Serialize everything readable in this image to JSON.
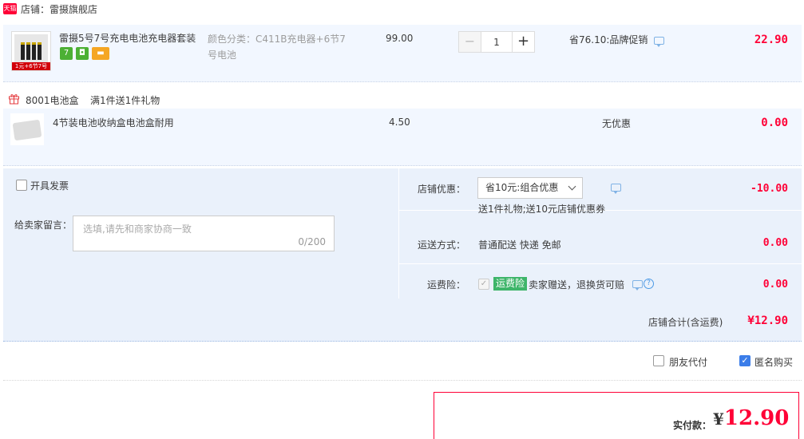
{
  "shop": {
    "badge": "天猫",
    "name": "店铺：雷摄旗舰店"
  },
  "item": {
    "title": "雷摄5号7号充电电池充电器套装",
    "thumb_label": "1元+6节7号",
    "service_icons": [
      {
        "name": "seven-day-icon",
        "glyph": "7",
        "color": "#4cb034"
      },
      {
        "name": "guarantee-icon",
        "glyph": "◘",
        "color": "#4cb034"
      },
      {
        "name": "card-icon",
        "glyph": "▬",
        "color": "#f5a623"
      }
    ],
    "sku": "颜色分类：C411B充电器+6节7号电池",
    "price": "99.00",
    "qty": "1",
    "qty_minus": "−",
    "qty_plus": "+",
    "promo": "省76.10:品牌促销",
    "subtotal": "22.90"
  },
  "gift": {
    "name": "8001电池盒",
    "rule": "满1件送1件礼物",
    "title": "4节装电池收纳盒电池盒耐用",
    "price": "4.50",
    "promo": "无优惠",
    "subtotal": "0.00"
  },
  "options": {
    "invoice_label": "开具发票",
    "message_label": "给卖家留言：",
    "message_placeholder": "选填,请先和商家协商一致",
    "message_count": "0/200",
    "shop_discount_label": "店铺优惠：",
    "shop_discount_value": "省10元:组合优惠",
    "shop_discount_note": "送1件礼物;送10元店铺优惠券",
    "shop_discount_amount": "-10.00",
    "shipping_label": "运送方式：",
    "shipping_value": "普通配送 快递 免邮",
    "shipping_amount": "0.00",
    "insurance_label": "运费险：",
    "insurance_tag": "运费险",
    "insurance_text": "卖家赠送，退换货可赔",
    "insurance_amount": "0.00"
  },
  "total": {
    "label": "店铺合计(含运费)",
    "value": "¥12.90"
  },
  "checkout": {
    "friend_pay": "朋友代付",
    "anonymous": "匿名购买",
    "pay_label": "实付款：",
    "pay_currency": "¥",
    "pay_value": "12.90"
  },
  "colors": {
    "accent": "#ff0036",
    "panel": "#eaf1fb",
    "row": "#f2f7ff",
    "check": "#3b7de9"
  }
}
